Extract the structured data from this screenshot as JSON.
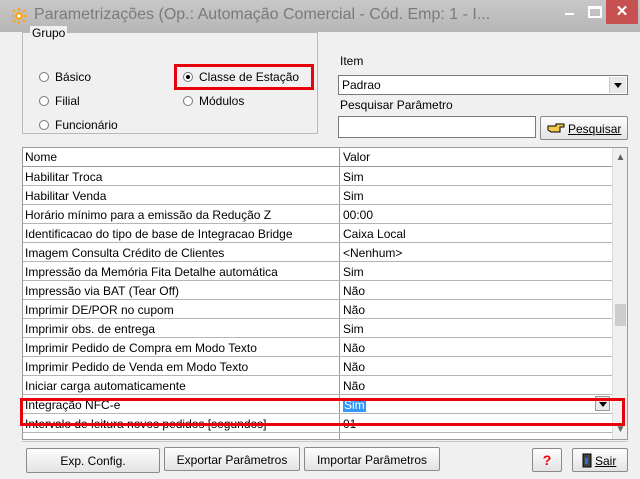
{
  "window": {
    "title": "Parametrizações (Op.: Automação Comercial - Cód. Emp: 1 - I..."
  },
  "grupo": {
    "legend": "Grupo",
    "options": [
      "Básico",
      "Filial",
      "Funcionário",
      "Classe de Estação",
      "Módulos"
    ],
    "selected": "Classe de Estação"
  },
  "item": {
    "label": "Item",
    "value": "Padrao"
  },
  "search": {
    "label": "Pesquisar Parâmetro",
    "value": "",
    "button_label": "Pesquisar"
  },
  "grid": {
    "columns": [
      "Nome",
      "Valor"
    ],
    "rows": [
      {
        "name": "Habilitar Troca",
        "value": "Sim"
      },
      {
        "name": "Habilitar Venda",
        "value": "Sim"
      },
      {
        "name": "Horário mínimo para a emissão da Redução Z",
        "value": "00:00"
      },
      {
        "name": "Identificacao do tipo de base de Integracao Bridge",
        "value": "Caixa Local"
      },
      {
        "name": "Imagem Consulta Crédito de Clientes",
        "value": "<Nenhum>"
      },
      {
        "name": "Impressão da Memória Fita Detalhe automática",
        "value": "Sim"
      },
      {
        "name": "Impressão via BAT (Tear Off)",
        "value": "Não"
      },
      {
        "name": "Imprimir DE/POR no cupom",
        "value": "Não"
      },
      {
        "name": "Imprimir obs. de entrega",
        "value": "Sim"
      },
      {
        "name": "Imprimir Pedido de Compra em Modo Texto",
        "value": "Não"
      },
      {
        "name": "Imprimir Pedido de Venda em Modo Texto",
        "value": "Não"
      },
      {
        "name": "Iniciar carga automaticamente",
        "value": "Não"
      },
      {
        "name": "Integração NFC-e",
        "value": "Sim"
      },
      {
        "name": "Intervalo de leitura novos pedidos [segundos]",
        "value": "01"
      }
    ],
    "selected_row": "Integração NFC-e"
  },
  "footer": {
    "exp_config": "Exp. Config.",
    "exportar": "Exportar Parâmetros",
    "importar": "Importar Parâmetros",
    "help": "?",
    "sair": "Sair"
  },
  "colors": {
    "highlight": "#e8000b",
    "selection": "#3399ff",
    "close_button": "#c75050"
  },
  "icons": [
    "app-icon",
    "pointing-hand-icon",
    "exit-door-icon"
  ]
}
